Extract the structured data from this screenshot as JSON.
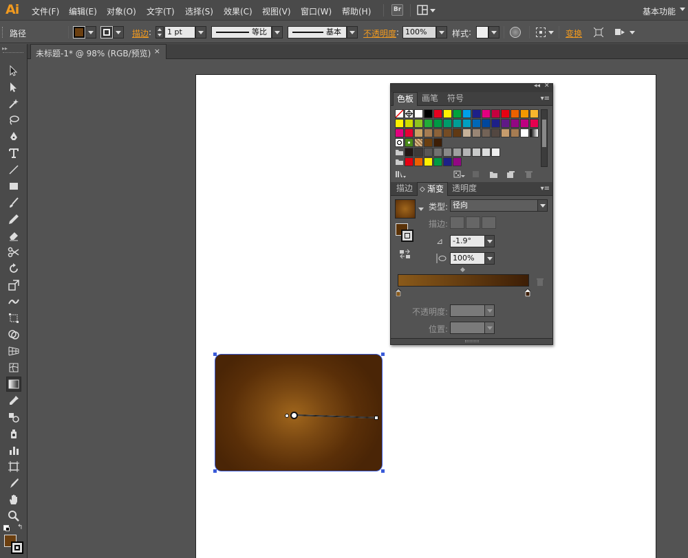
{
  "app": {
    "logo": "Ai"
  },
  "menu": [
    "文件(F)",
    "编辑(E)",
    "对象(O)",
    "文字(T)",
    "选择(S)",
    "效果(C)",
    "视图(V)",
    "窗口(W)",
    "帮助(H)"
  ],
  "bridge_label": "Br",
  "workspace": "基本功能",
  "control": {
    "object_type": "路径",
    "stroke_label": "描边",
    "stroke_weight": "1 pt",
    "profile": "等比",
    "brush": "基本",
    "opacity_label": "不透明度",
    "opacity": "100%",
    "style_label": "样式",
    "transform_label": "变换",
    "fill_color": "#6b3f10"
  },
  "document_tab": {
    "title": "未标题-1* @ 98% (RGB/预览)",
    "close": "×"
  },
  "panel": {
    "top_tabs": [
      "色板",
      "画笔",
      "符号"
    ],
    "bottom_tabs": [
      "描边",
      "渐变",
      "透明度"
    ],
    "gradient": {
      "type_label": "类型:",
      "type_value": "径向",
      "stroke_label": "描边:",
      "angle": "-1.9°",
      "aspect": "100%",
      "opacity_label": "不透明度:",
      "location_label": "位置:",
      "start_color": "#8a5a1a",
      "end_color": "#3d1e06"
    },
    "swatch_rows": [
      [
        "none",
        "reg",
        "#ffffff",
        "#000000",
        "#e6001f",
        "#fff100",
        "#00a23b",
        "#00a0e9",
        "#1d2088",
        "#e4007f",
        "#c5003e",
        "#e60012",
        "#eb6100",
        "#f39800",
        "#f8b62d"
      ],
      [
        "#fff100",
        "#cfdb00",
        "#8fc31f",
        "#22ac38",
        "#009944",
        "#009b6b",
        "#009e96",
        "#00a0c1",
        "#0068b7",
        "#00479d",
        "#1d2088",
        "#601986",
        "#920783",
        "#be0081",
        "#e5004f"
      ],
      [
        "#e4007f",
        "#e60033",
        "#c9a063",
        "#a67c52",
        "#8c6239",
        "#754c24",
        "#603913",
        "#c7b299",
        "#998675",
        "#736357",
        "#534741",
        "#c69c6d",
        "#a67c52",
        "#ffffff",
        "grad"
      ],
      [
        "pattern1",
        "pattern2",
        "pattern3",
        "#6b3f10",
        "#3d1e06"
      ],
      [
        "folder",
        "#231815",
        "#3e3a39",
        "#595757",
        "#727171",
        "#898989",
        "#9fa0a0",
        "#b5b5b6",
        "#c9caca",
        "#dcdddd",
        "#efefef"
      ],
      [
        "folder",
        "#e60012",
        "#eb6100",
        "#fff100",
        "#009944",
        "#1d2088",
        "#920783"
      ]
    ]
  }
}
